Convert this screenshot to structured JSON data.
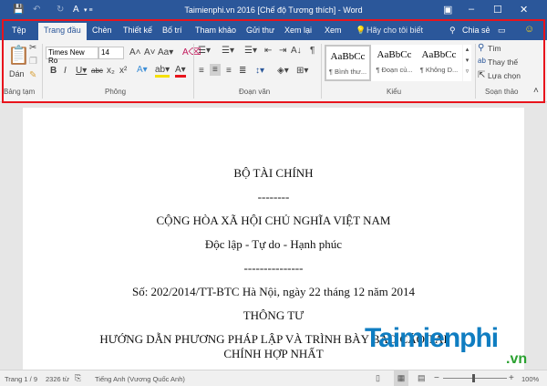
{
  "title": "Taimienphi.vn  2016 [Chế độ Tương thích]  -  Word",
  "tabs": [
    "Tệp",
    "Trang đầu",
    "Chèn",
    "Thiết kế",
    "Bố trí",
    "Tham khảo",
    "Gửi thư",
    "Xem lại",
    "Xem"
  ],
  "tell_me": "Hãy cho tôi biết",
  "share": "Chia sẻ",
  "ribbon": {
    "paste": "Dán",
    "clipboard_group": "Bảng tạm",
    "font_name": "Times New Ro",
    "font_size": "14",
    "font_group": "Phông",
    "paragraph_group": "Đoạn văn",
    "styles": [
      {
        "preview": "AaBbCc",
        "name": "¶ Bình thư..."
      },
      {
        "preview": "AaBbCc",
        "name": "¶ Đoạn củ..."
      },
      {
        "preview": "AaBbCc",
        "name": "¶ Không D..."
      }
    ],
    "styles_group": "Kiểu",
    "find": "Tìm",
    "replace": "Thay thế",
    "select": "Lựa chọn",
    "editing_group": "Soạn thảo"
  },
  "document": {
    "lines": [
      "BỘ TÀI CHÍNH",
      "--------",
      "CỘNG HÒA XÃ HỘI CHỦ NGHĨA VIỆT NAM",
      "Độc lập - Tự do - Hạnh phúc",
      "---------------",
      "Số: 202/2014/TT-BTC Hà Nội, ngày 22 tháng 12 năm 2014",
      "THÔNG TƯ",
      "HƯỚNG DẪN PHƯƠNG PHÁP LẬP VÀ TRÌNH BÀY BÁO CÁO TÀI",
      "CHÍNH HỢP NHẤT"
    ]
  },
  "watermark": {
    "main": "Taimienphi",
    ".vn": ".vn"
  },
  "status": {
    "page": "Trang 1 / 9",
    "words": "2326 từ",
    "language": "Tiếng Anh (Vương Quốc Anh)",
    "zoom": "100%"
  },
  "colors": {
    "accent": "#2b579a",
    "highlight": "#e8141c"
  }
}
